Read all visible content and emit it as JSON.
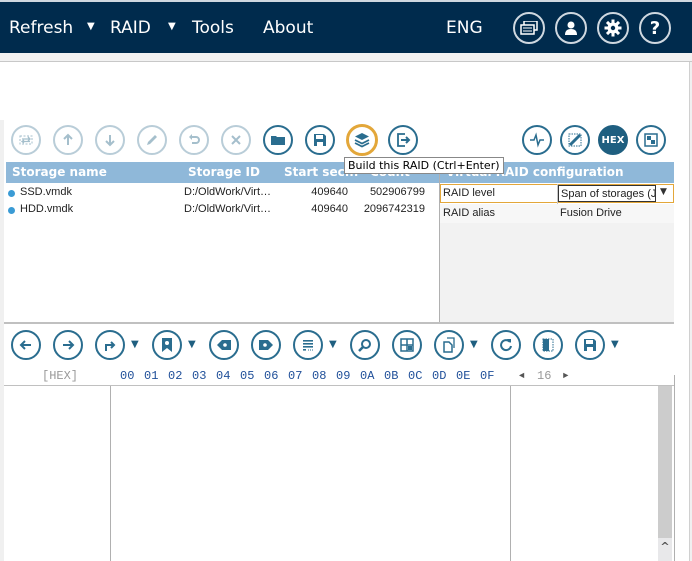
{
  "menubar": {
    "items": [
      {
        "label": "Refresh",
        "has_dropdown": true
      },
      {
        "label": "RAID",
        "has_dropdown": true
      },
      {
        "label": "Tools",
        "has_dropdown": false
      },
      {
        "label": "About",
        "has_dropdown": false
      }
    ],
    "language": "ENG",
    "icons": [
      "windows-icon",
      "user-icon",
      "gear-icon",
      "help-icon"
    ],
    "dropdown_glyph": "▼"
  },
  "toolbar_top": {
    "buttons": [
      {
        "icon": "swap-icon",
        "enabled": false
      },
      {
        "icon": "arrow-up-icon",
        "enabled": false
      },
      {
        "icon": "arrow-down-icon",
        "enabled": false
      },
      {
        "icon": "pencil-icon",
        "enabled": false
      },
      {
        "icon": "undo-icon",
        "enabled": false
      },
      {
        "icon": "close-icon",
        "enabled": false
      },
      {
        "icon": "folder-icon",
        "enabled": true
      },
      {
        "icon": "save-icon",
        "enabled": true
      },
      {
        "icon": "layers-icon",
        "enabled": true,
        "highlighted": true
      },
      {
        "icon": "export-icon",
        "enabled": true
      }
    ],
    "right_buttons": [
      {
        "icon": "pulse-icon"
      },
      {
        "icon": "grid-map-icon"
      },
      {
        "icon": "hex-icon",
        "label": "HEX",
        "active": true
      },
      {
        "icon": "blocks-icon"
      }
    ],
    "tooltip": "Build this RAID (Ctrl+Enter)"
  },
  "storage_table": {
    "columns": [
      "Storage name",
      "Storage ID",
      "Start sec...",
      "Count sec..."
    ],
    "rows": [
      {
        "name": "SSD.vmdk",
        "id": "D:/OldWork/Virt…",
        "start": "409640",
        "count": "502906799"
      },
      {
        "name": "HDD.vmdk",
        "id": "D:/OldWork/Virt…",
        "start": "409640",
        "count": "2096742319"
      }
    ]
  },
  "raid_config": {
    "title": "Virtual RAID configuration",
    "rows": [
      {
        "key": "RAID level",
        "value": "Span of storages (J",
        "dropdown": true
      },
      {
        "key": "RAID alias",
        "value": "Fusion Drive",
        "dropdown": false
      }
    ]
  },
  "toolbar_bottom": {
    "buttons": [
      "back-icon",
      "forward-icon",
      "jump-icon",
      "bookmark-icon",
      "prev-bookmark-icon",
      "next-bookmark-icon",
      "list-icon",
      "search-icon",
      "grid-icon",
      "copy-icon",
      "refresh-icon",
      "panel-icon",
      "save-icon"
    ]
  },
  "hex_view": {
    "mode_label": "[HEX]",
    "columns": [
      "00",
      "01",
      "02",
      "03",
      "04",
      "05",
      "06",
      "07",
      "08",
      "09",
      "0A",
      "0B",
      "0C",
      "0D",
      "0E",
      "0F"
    ],
    "width_value": "16",
    "prev_glyph": "◄",
    "next_glyph": "►"
  }
}
